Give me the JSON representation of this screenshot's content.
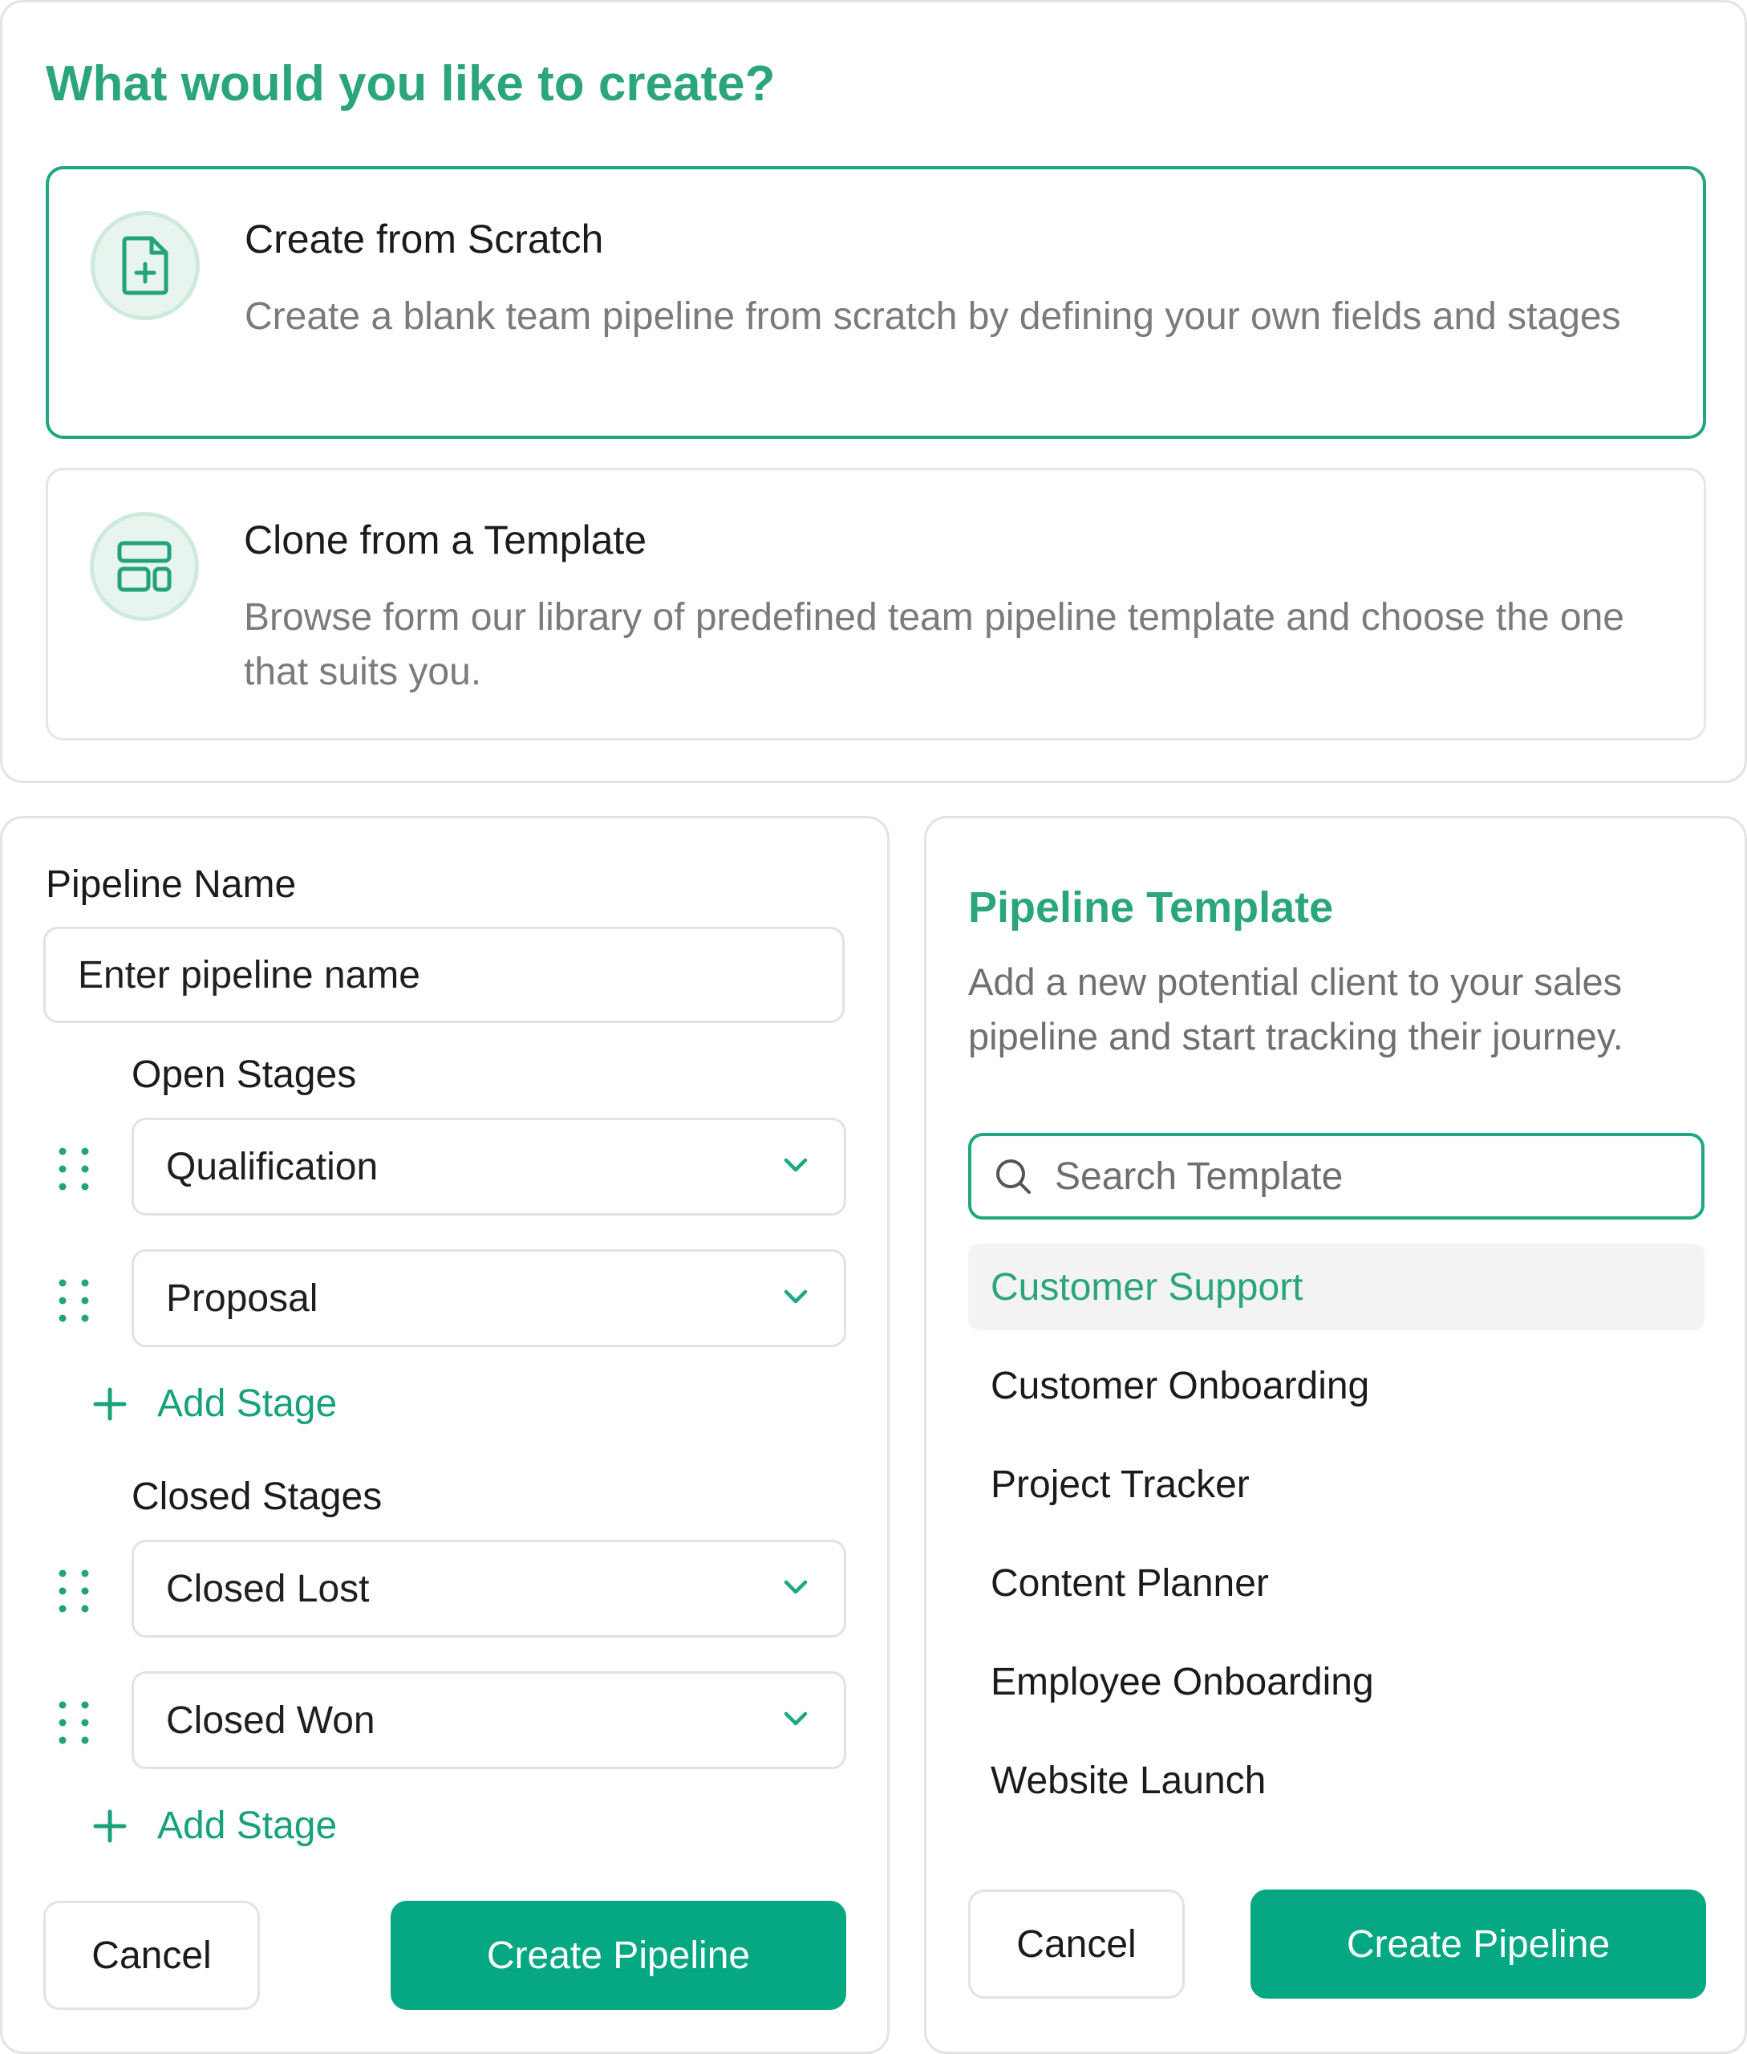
{
  "create_panel": {
    "title": "What would you like to create?",
    "options": [
      {
        "title": "Create from Scratch",
        "description": "Create a blank team pipeline from scratch by defining your own fields and stages",
        "icon": "file-plus-icon",
        "selected": true
      },
      {
        "title": "Clone from a Template",
        "description": "Browse form our library of predefined team pipeline template and choose the one that suits you.",
        "icon": "layout-template-icon",
        "selected": false
      }
    ]
  },
  "pipeline_form": {
    "name_label": "Pipeline Name",
    "name_value": "Enter pipeline name",
    "open_stages_label": "Open Stages",
    "open_stages": [
      "Qualification",
      "Proposal"
    ],
    "closed_stages_label": "Closed Stages",
    "closed_stages": [
      "Closed Lost",
      "Closed Won"
    ],
    "add_stage_label": "Add Stage",
    "cancel_label": "Cancel",
    "create_label": "Create Pipeline"
  },
  "template_panel": {
    "title": "Pipeline Template",
    "description": "Add a new potential client to your sales pipeline and start tracking their journey.",
    "search_placeholder": "Search Template",
    "templates": [
      "Customer Support",
      "Customer Onboarding",
      "Project Tracker",
      "Content Planner",
      "Employee Onboarding",
      "Website Launch"
    ],
    "active_template": "Customer Support",
    "cancel_label": "Cancel",
    "create_label": "Create Pipeline"
  },
  "colors": {
    "accent": "#2aa57e",
    "primary_button": "#05a882",
    "border": "#e3e3e3",
    "muted_text": "#7b7b7b"
  }
}
